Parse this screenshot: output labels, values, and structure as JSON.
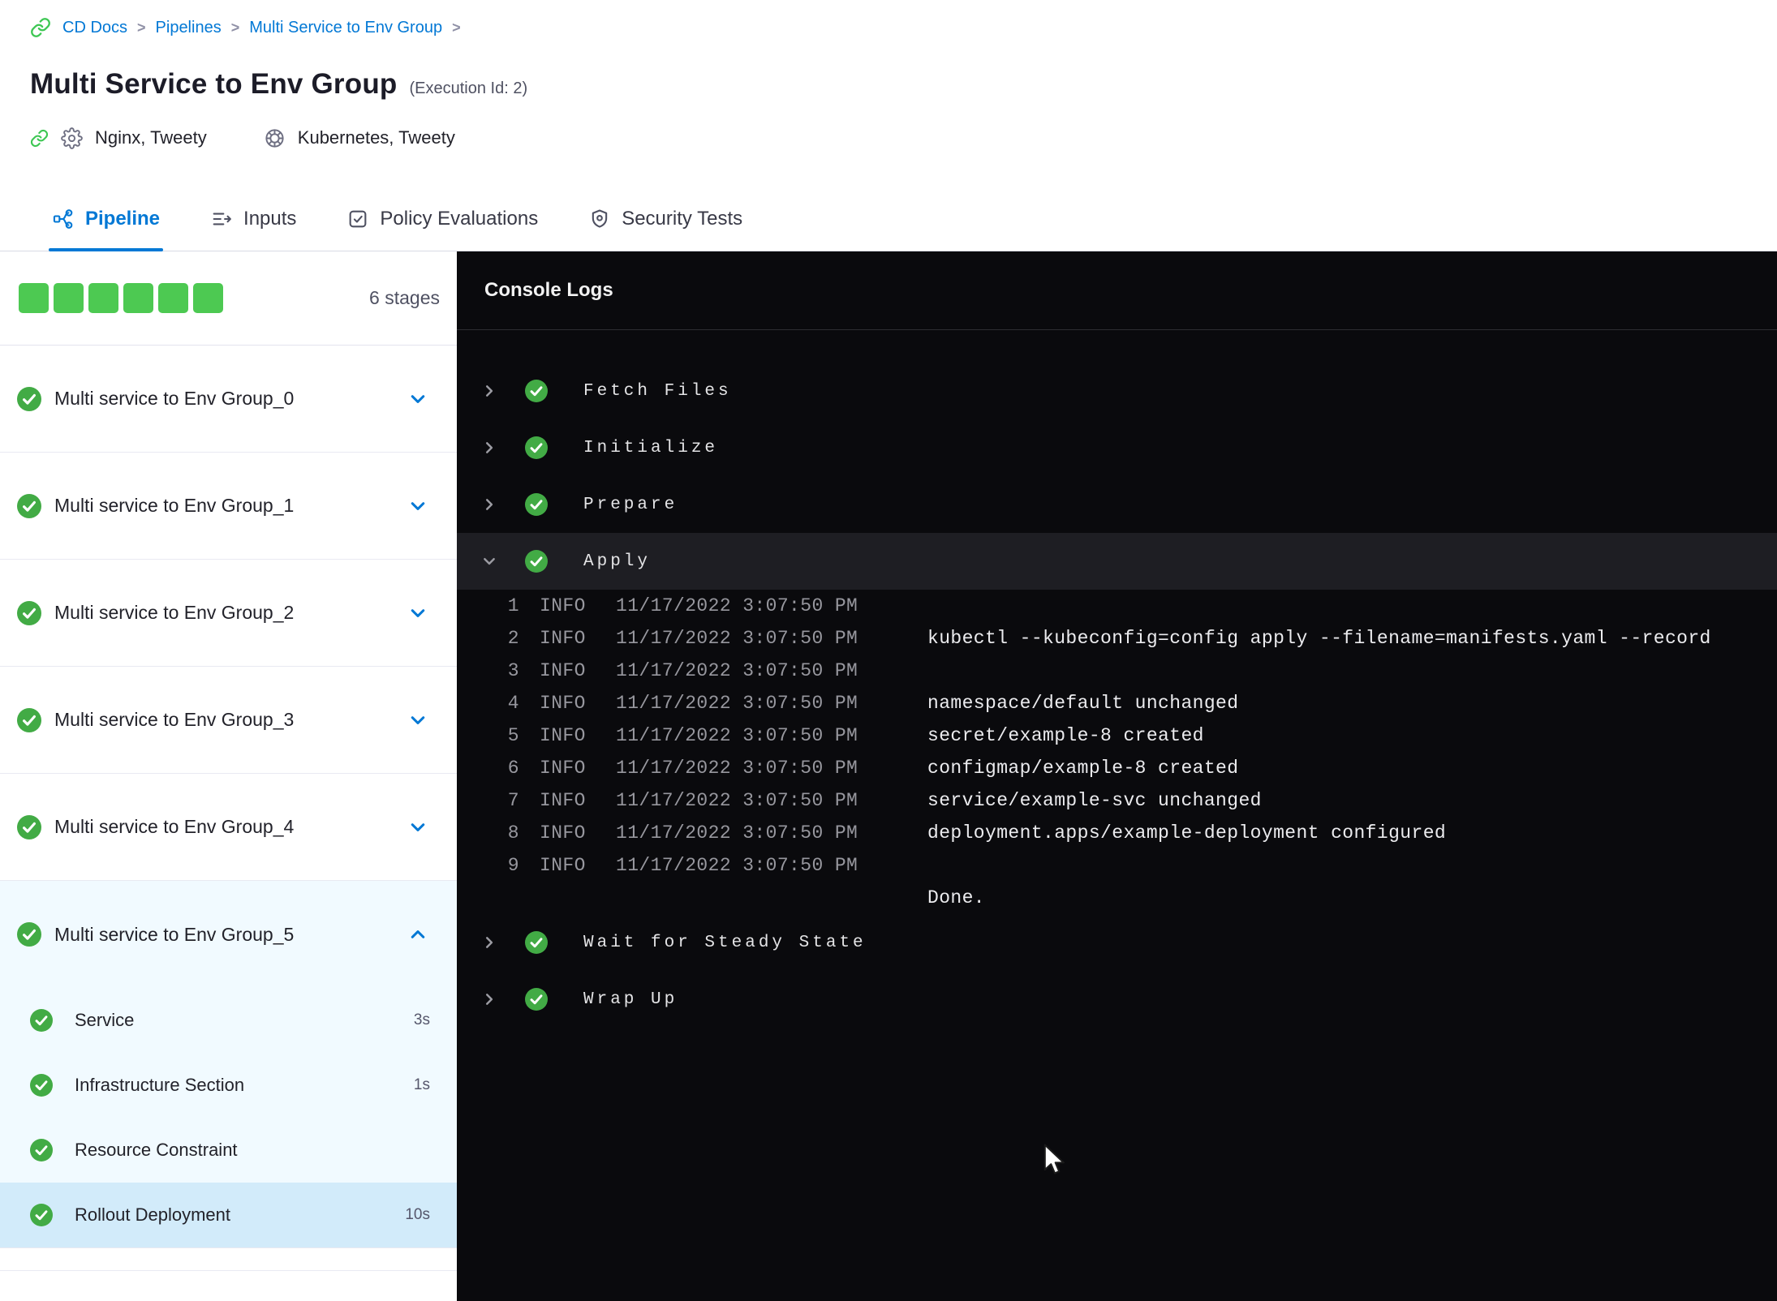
{
  "colors": {
    "accent_blue": "#0278d5",
    "success_green": "#4dc952",
    "check_green": "#42ab45",
    "console_bg": "#0a0a0d",
    "expanded_stage_bg": "#f1faff",
    "selected_step_bg": "#d2ebfa"
  },
  "breadcrumb": {
    "icon": "cd-link-icon",
    "items": [
      "CD Docs",
      "Pipelines",
      "Multi Service to Env Group"
    ],
    "separator": ">"
  },
  "header": {
    "title": "Multi Service to Env Group",
    "execution_id": "(Execution Id: 2)",
    "services": {
      "icon_link": "link-icon",
      "icon_gear": "gear-icon",
      "label": "Nginx, Tweety"
    },
    "environments": {
      "icon": "environment-icon",
      "label": "Kubernetes, Tweety"
    }
  },
  "tabs": [
    {
      "label": "Pipeline",
      "icon": "pipeline-icon",
      "active": true
    },
    {
      "label": "Inputs",
      "icon": "inputs-icon",
      "active": false
    },
    {
      "label": "Policy Evaluations",
      "icon": "policy-checkbox-icon",
      "active": false
    },
    {
      "label": "Security Tests",
      "icon": "security-shield-icon",
      "active": false
    }
  ],
  "sidebar": {
    "stage_count_label": "6 stages",
    "completed_squares": 6,
    "stages": [
      {
        "label": "Multi service to Env Group_0",
        "status": "success",
        "expanded": false
      },
      {
        "label": "Multi service to Env Group_1",
        "status": "success",
        "expanded": false
      },
      {
        "label": "Multi service to Env Group_2",
        "status": "success",
        "expanded": false
      },
      {
        "label": "Multi service to Env Group_3",
        "status": "success",
        "expanded": false
      },
      {
        "label": "Multi service to Env Group_4",
        "status": "success",
        "expanded": false
      },
      {
        "label": "Multi service to Env Group_5",
        "status": "success",
        "expanded": true,
        "steps": [
          {
            "label": "Service",
            "duration": "3s",
            "status": "success",
            "selected": false
          },
          {
            "label": "Infrastructure Section",
            "duration": "1s",
            "status": "success",
            "selected": false
          },
          {
            "label": "Resource Constraint",
            "duration": "",
            "status": "success",
            "selected": false
          },
          {
            "label": "Rollout Deployment",
            "duration": "10s",
            "status": "success",
            "selected": true
          }
        ]
      }
    ]
  },
  "console": {
    "title": "Console Logs",
    "steps": [
      {
        "label": "Fetch Files",
        "status": "success",
        "expanded": false
      },
      {
        "label": "Initialize",
        "status": "success",
        "expanded": false
      },
      {
        "label": "Prepare",
        "status": "success",
        "expanded": false
      },
      {
        "label": "Apply",
        "status": "success",
        "expanded": true,
        "logs": [
          {
            "n": "1",
            "level": "INFO",
            "time": "11/17/2022 3:07:50 PM",
            "message": ""
          },
          {
            "n": "2",
            "level": "INFO",
            "time": "11/17/2022 3:07:50 PM",
            "message": "kubectl --kubeconfig=config apply --filename=manifests.yaml --record"
          },
          {
            "n": "3",
            "level": "INFO",
            "time": "11/17/2022 3:07:50 PM",
            "message": ""
          },
          {
            "n": "4",
            "level": "INFO",
            "time": "11/17/2022 3:07:50 PM",
            "message": "namespace/default unchanged"
          },
          {
            "n": "5",
            "level": "INFO",
            "time": "11/17/2022 3:07:50 PM",
            "message": "secret/example-8 created"
          },
          {
            "n": "6",
            "level": "INFO",
            "time": "11/17/2022 3:07:50 PM",
            "message": "configmap/example-8 created"
          },
          {
            "n": "7",
            "level": "INFO",
            "time": "11/17/2022 3:07:50 PM",
            "message": "service/example-svc unchanged"
          },
          {
            "n": "8",
            "level": "INFO",
            "time": "11/17/2022 3:07:50 PM",
            "message": "deployment.apps/example-deployment configured"
          },
          {
            "n": "9",
            "level": "INFO",
            "time": "11/17/2022 3:07:50 PM",
            "message": ""
          }
        ],
        "tail": "Done."
      },
      {
        "label": "Wait for Steady State",
        "status": "success",
        "expanded": false
      },
      {
        "label": "Wrap Up",
        "status": "success",
        "expanded": false
      }
    ]
  }
}
